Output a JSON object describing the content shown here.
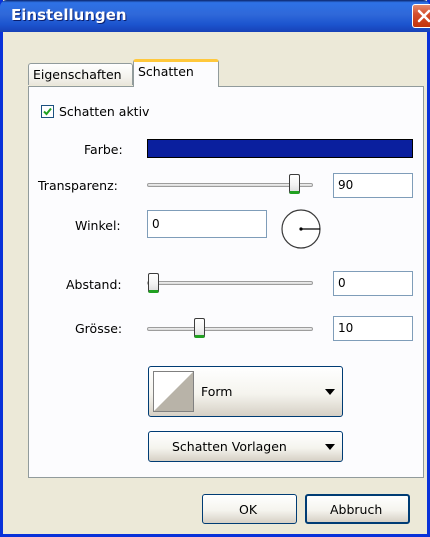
{
  "window": {
    "title": "Einstellungen"
  },
  "tabs": [
    "Eigenschaften",
    "Schatten"
  ],
  "shadow": {
    "enabled_label": "Schatten aktiv",
    "enabled": true,
    "color_label": "Farbe:",
    "color_value": "#0A1F9E",
    "transparency_label": "Transparenz:",
    "transparency_value": "90",
    "angle_label": "Winkel:",
    "angle_value": "0",
    "distance_label": "Abstand:",
    "distance_value": "0",
    "size_label": "Grösse:",
    "size_value": "10",
    "form_label": "Form",
    "presets_label": "Schatten Vorlagen"
  },
  "footer": {
    "ok_label": "OK",
    "cancel_label": "Abbruch"
  },
  "colors": {
    "accent": "#2F68D9",
    "tab_highlight": "#FFC83C",
    "slider_grip": "#21A121"
  }
}
